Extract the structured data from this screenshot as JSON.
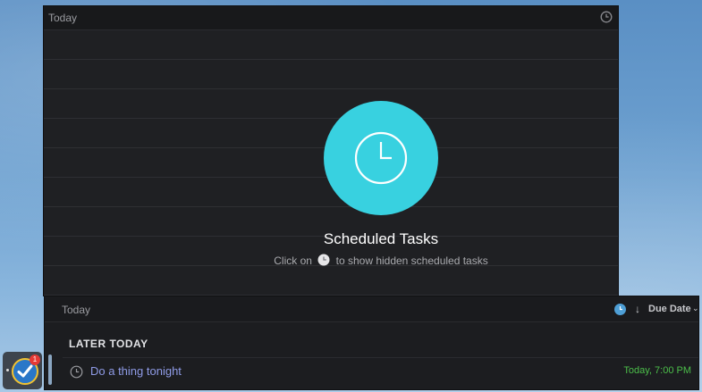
{
  "main_window": {
    "title": "Today",
    "empty_state": {
      "title": "Scheduled Tasks",
      "hint_before": "Click on",
      "hint_after": "to show hidden scheduled tasks"
    }
  },
  "bottom_window": {
    "title": "Today",
    "sort": {
      "direction_glyph": "↓",
      "label": "Due Date",
      "chevron": "⌄"
    },
    "section": "LATER TODAY",
    "tasks": [
      {
        "name": "Do a thing tonight",
        "due": "Today, 7:00 PM"
      }
    ]
  },
  "dock": {
    "badge_count": "1"
  },
  "colors": {
    "accent_cyan": "#38d1e0",
    "task_blue": "#8f9be6",
    "due_green": "#4cbf4a",
    "badge_red": "#e53935"
  },
  "icons": {
    "header_clock": "clock-icon",
    "hero_clock": "clock-icon",
    "task_clock": "clock-icon",
    "app": "checkmark-app-icon"
  }
}
